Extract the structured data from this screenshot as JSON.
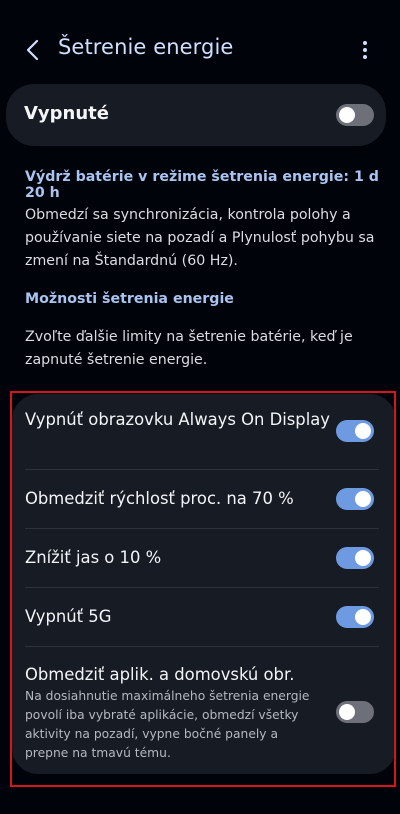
{
  "header": {
    "title": "Šetrenie energie",
    "back_icon": "chevron-left-icon",
    "more_icon": "more-vertical-icon"
  },
  "master": {
    "label": "Vypnuté",
    "state": "off"
  },
  "battery_estimate": "Výdrž batérie v režime šetrenia energie: 1 d 20 h",
  "description": "Obmedzí sa synchronizácia, kontrola polohy a používanie siete na pozadí a Plynulosť pohybu sa zmení na Štandardnú (60 Hz).",
  "options_link": "Možnosti šetrenia energie",
  "options_description": "Zvoľte ďalšie limity na šetrenie batérie, keď je zapnuté šetrenie energie.",
  "options": [
    {
      "label": "Vypnúť obrazovku Always On Display",
      "state": "on"
    },
    {
      "label": "Obmedziť rýchlosť proc. na 70 %",
      "state": "on"
    },
    {
      "label": "Znížiť jas o 10 %",
      "state": "on"
    },
    {
      "label": "Vypnúť 5G",
      "state": "on"
    },
    {
      "label": "Obmedziť aplik. a domovskú obr.",
      "description": "Na dosiahnutie maximálneho šetrenia energie povolí iba vybraté aplikácie, obmedzí všetky aktivity na pozadí, vypne bočné panely a prepne na tmavú tému.",
      "state": "off"
    }
  ],
  "colors": {
    "background": "#01030a",
    "card": "#161b24",
    "accent": "#6d9ae0",
    "link": "#a8c4f0",
    "highlight": "#d6161c"
  }
}
